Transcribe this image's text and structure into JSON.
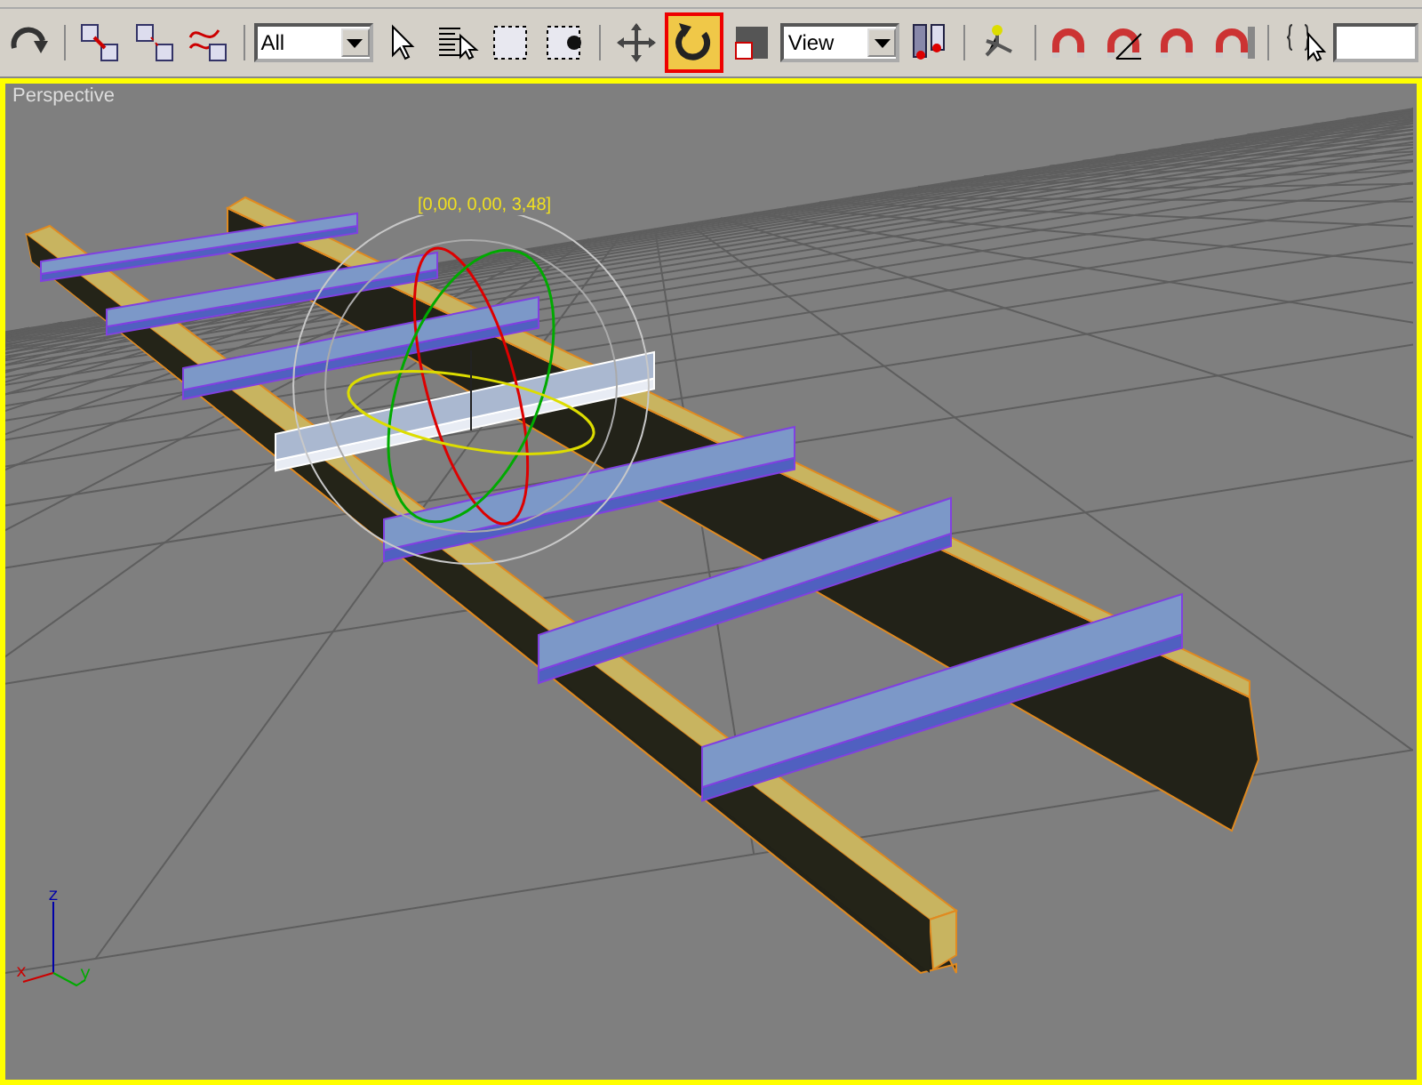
{
  "toolbar": [
    {
      "kind": "button",
      "selected": false
    },
    {
      "kind": "separator"
    },
    {
      "kind": "button",
      "selected": false
    },
    {
      "kind": "button",
      "selected": false
    },
    {
      "kind": "button",
      "selected": false
    },
    {
      "kind": "separator"
    },
    {
      "kind": "dropdown",
      "value": "All"
    },
    {
      "kind": "button",
      "selected": false
    },
    {
      "kind": "button",
      "selected": false
    },
    {
      "kind": "button",
      "selected": false
    },
    {
      "kind": "button",
      "selected": false
    },
    {
      "kind": "separator"
    },
    {
      "kind": "button",
      "selected": false
    },
    {
      "kind": "button",
      "selected": true
    },
    {
      "kind": "button",
      "selected": false
    },
    {
      "kind": "dropdown",
      "value": "View"
    },
    {
      "kind": "button",
      "selected": false
    },
    {
      "kind": "separator"
    },
    {
      "kind": "button",
      "selected": false
    },
    {
      "kind": "separator"
    },
    {
      "kind": "button",
      "selected": false
    },
    {
      "kind": "button",
      "selected": false
    },
    {
      "kind": "button",
      "selected": false
    },
    {
      "kind": "button",
      "selected": false
    },
    {
      "kind": "separator"
    },
    {
      "kind": "button",
      "selected": false
    },
    {
      "kind": "field"
    }
  ],
  "viewport": {
    "label": "Perspective",
    "active": true,
    "coordinates": "[0,00, 0,00, 3,48]",
    "planks": [
      {
        "selected": false
      },
      {
        "selected": false
      },
      {
        "selected": false
      },
      {
        "selected": true
      },
      {
        "selected": false
      },
      {
        "selected": false
      },
      {
        "selected": false
      }
    ],
    "axes": {
      "x": "x",
      "y": "y",
      "z": "z"
    }
  }
}
